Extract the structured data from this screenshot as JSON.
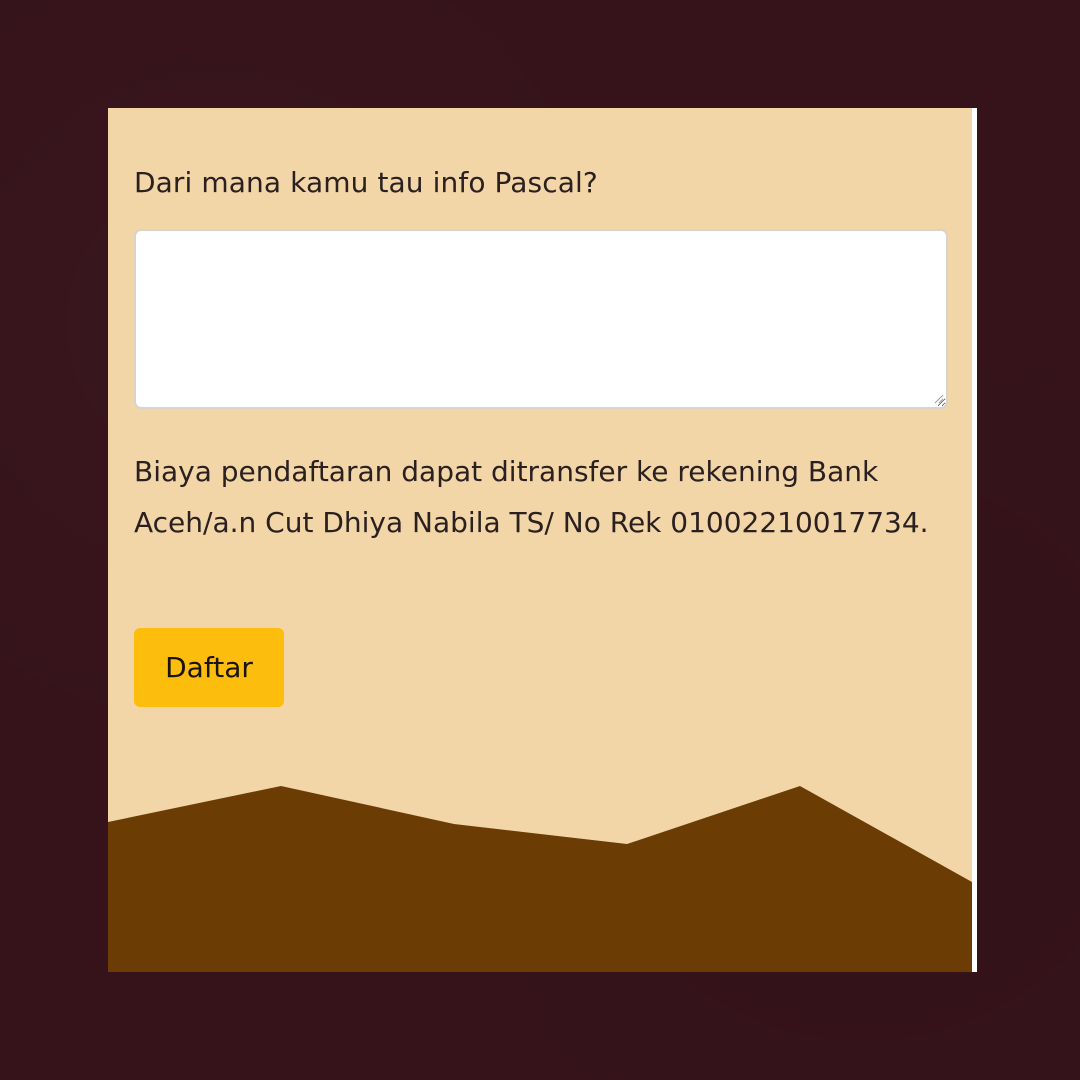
{
  "form": {
    "question_label": "Dari mana kamu tau info Pascal?",
    "answer_value": "",
    "info_text": "Biaya pendaftaran dapat ditransfer ke rekening Bank Aceh/a.n Cut Dhiya Nabila TS/ No Rek 01002210017734.",
    "submit_label": "Daftar"
  },
  "theme": {
    "page_background": "#36131b",
    "panel_background": "#f3d6a8",
    "button_color": "#fdbd0c",
    "mountain_color": "#6b3d04",
    "text_color": "#2a2020"
  },
  "decoration": {
    "footer_graphic": "mountain-silhouette"
  }
}
